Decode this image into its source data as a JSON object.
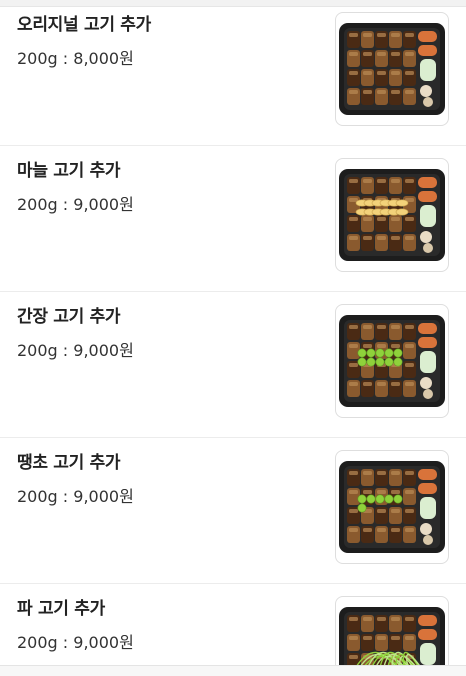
{
  "menu": {
    "items": [
      {
        "name": "오리지널 고기 추가",
        "price": "200g : 8,000원",
        "image": "box-original-meat",
        "topping": "none"
      },
      {
        "name": "마늘 고기 추가",
        "price": "200g : 9,000원",
        "image": "box-garlic-meat",
        "topping": "garlic"
      },
      {
        "name": "간장 고기 추가",
        "price": "200g : 9,000원",
        "image": "box-soy-meat",
        "topping": "green-onion"
      },
      {
        "name": "땡초 고기 추가",
        "price": "200g : 9,000원",
        "image": "box-chili-meat",
        "topping": "green-chili"
      },
      {
        "name": "파 고기 추가",
        "price": "200g : 9,000원",
        "image": "box-scallion-meat",
        "topping": "scallion"
      }
    ]
  },
  "colors": {
    "container": "#1d1d1d",
    "meat_light": "#8a5a2e",
    "meat_dark": "#4a2a14",
    "garlic": "#f3d27a",
    "green": "#8fd13b",
    "bokchoy": "#dbeed0",
    "sausage": "#d9733a"
  }
}
